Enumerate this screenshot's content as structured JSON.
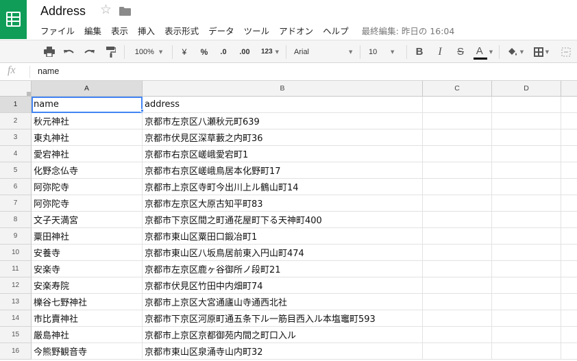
{
  "app": {
    "title": "Address",
    "last_edit": "最終編集: 昨日の 16:04",
    "star_icon": "☆",
    "folder_icon": "folder-icon"
  },
  "menu": {
    "items": [
      "ファイル",
      "編集",
      "表示",
      "挿入",
      "表示形式",
      "データ",
      "ツール",
      "アドオン",
      "ヘルプ"
    ]
  },
  "toolbar": {
    "zoom": "100%",
    "currency": "¥",
    "percent": "%",
    "decimal_decrease": ".0",
    "decimal_increase": ".00",
    "number_format": "123",
    "font": "Arial",
    "font_size": "10",
    "bold": "B",
    "italic": "I",
    "strike": "S",
    "text_color": "A"
  },
  "formula_bar": {
    "fx": "fx",
    "value": "name"
  },
  "grid": {
    "columns": [
      "A",
      "B",
      "C",
      "D"
    ],
    "rows": [
      {
        "num": "1",
        "a": "name",
        "b": "address"
      },
      {
        "num": "2",
        "a": "秋元神社",
        "b": "京都市左京区八瀬秋元町639"
      },
      {
        "num": "3",
        "a": "東丸神社",
        "b": "京都市伏見区深草藪之内町36"
      },
      {
        "num": "4",
        "a": "愛宕神社",
        "b": "京都市右京区嵯峨愛宕町1"
      },
      {
        "num": "5",
        "a": "化野念仏寺",
        "b": "京都市右京区嵯峨鳥居本化野町17"
      },
      {
        "num": "6",
        "a": "阿弥陀寺",
        "b": "京都市上京区寺町今出川上ル鶴山町14"
      },
      {
        "num": "7",
        "a": "阿弥陀寺",
        "b": "京都市左京区大原古知平町83"
      },
      {
        "num": "8",
        "a": "文子天満宮",
        "b": "京都市下京区間之町通花屋町下る天神町400"
      },
      {
        "num": "9",
        "a": "粟田神社",
        "b": "京都市東山区粟田口鍛冶町1"
      },
      {
        "num": "10",
        "a": "安養寺",
        "b": "京都市東山区八坂鳥居前東入円山町474"
      },
      {
        "num": "11",
        "a": "安楽寺",
        "b": "京都市左京区鹿ヶ谷御所ノ段町21"
      },
      {
        "num": "12",
        "a": "安楽寿院",
        "b": "京都市伏見区竹田中内畑町74"
      },
      {
        "num": "13",
        "a": "櫟谷七野神社",
        "b": "京都市上京区大宮通廬山寺通西北社"
      },
      {
        "num": "14",
        "a": "市比賣神社",
        "b": "京都市下京区河原町通五条下ル一筋目西入ル本塩竈町593"
      },
      {
        "num": "15",
        "a": "厳島神社",
        "b": "京都市上京区京都御苑内間之町口入ル"
      },
      {
        "num": "16",
        "a": "今熊野観音寺",
        "b": "京都市東山区泉涌寺山内町32"
      }
    ]
  },
  "colors": {
    "brand_green": "#0f9d58",
    "selection_blue": "#4285f4"
  }
}
